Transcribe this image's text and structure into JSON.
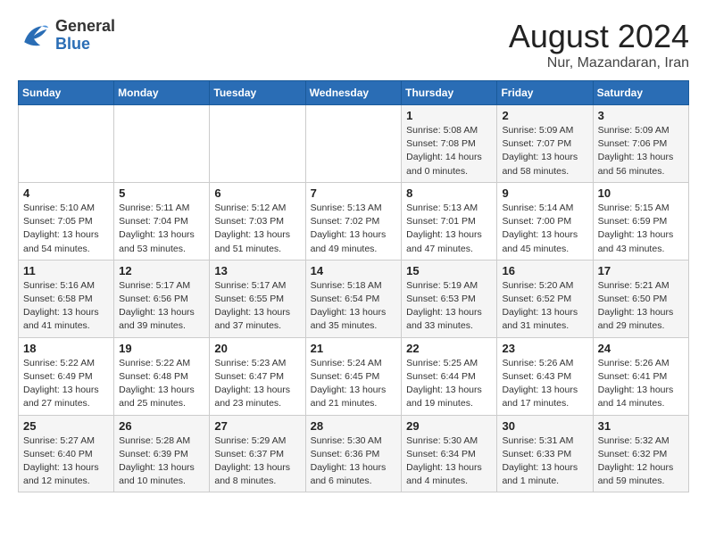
{
  "header": {
    "logo_general": "General",
    "logo_blue": "Blue",
    "title": "August 2024",
    "subtitle": "Nur, Mazandaran, Iran"
  },
  "calendar": {
    "days_of_week": [
      "Sunday",
      "Monday",
      "Tuesday",
      "Wednesday",
      "Thursday",
      "Friday",
      "Saturday"
    ],
    "weeks": [
      [
        {
          "day": "",
          "info": ""
        },
        {
          "day": "",
          "info": ""
        },
        {
          "day": "",
          "info": ""
        },
        {
          "day": "",
          "info": ""
        },
        {
          "day": "1",
          "info": "Sunrise: 5:08 AM\nSunset: 7:08 PM\nDaylight: 14 hours\nand 0 minutes."
        },
        {
          "day": "2",
          "info": "Sunrise: 5:09 AM\nSunset: 7:07 PM\nDaylight: 13 hours\nand 58 minutes."
        },
        {
          "day": "3",
          "info": "Sunrise: 5:09 AM\nSunset: 7:06 PM\nDaylight: 13 hours\nand 56 minutes."
        }
      ],
      [
        {
          "day": "4",
          "info": "Sunrise: 5:10 AM\nSunset: 7:05 PM\nDaylight: 13 hours\nand 54 minutes."
        },
        {
          "day": "5",
          "info": "Sunrise: 5:11 AM\nSunset: 7:04 PM\nDaylight: 13 hours\nand 53 minutes."
        },
        {
          "day": "6",
          "info": "Sunrise: 5:12 AM\nSunset: 7:03 PM\nDaylight: 13 hours\nand 51 minutes."
        },
        {
          "day": "7",
          "info": "Sunrise: 5:13 AM\nSunset: 7:02 PM\nDaylight: 13 hours\nand 49 minutes."
        },
        {
          "day": "8",
          "info": "Sunrise: 5:13 AM\nSunset: 7:01 PM\nDaylight: 13 hours\nand 47 minutes."
        },
        {
          "day": "9",
          "info": "Sunrise: 5:14 AM\nSunset: 7:00 PM\nDaylight: 13 hours\nand 45 minutes."
        },
        {
          "day": "10",
          "info": "Sunrise: 5:15 AM\nSunset: 6:59 PM\nDaylight: 13 hours\nand 43 minutes."
        }
      ],
      [
        {
          "day": "11",
          "info": "Sunrise: 5:16 AM\nSunset: 6:58 PM\nDaylight: 13 hours\nand 41 minutes."
        },
        {
          "day": "12",
          "info": "Sunrise: 5:17 AM\nSunset: 6:56 PM\nDaylight: 13 hours\nand 39 minutes."
        },
        {
          "day": "13",
          "info": "Sunrise: 5:17 AM\nSunset: 6:55 PM\nDaylight: 13 hours\nand 37 minutes."
        },
        {
          "day": "14",
          "info": "Sunrise: 5:18 AM\nSunset: 6:54 PM\nDaylight: 13 hours\nand 35 minutes."
        },
        {
          "day": "15",
          "info": "Sunrise: 5:19 AM\nSunset: 6:53 PM\nDaylight: 13 hours\nand 33 minutes."
        },
        {
          "day": "16",
          "info": "Sunrise: 5:20 AM\nSunset: 6:52 PM\nDaylight: 13 hours\nand 31 minutes."
        },
        {
          "day": "17",
          "info": "Sunrise: 5:21 AM\nSunset: 6:50 PM\nDaylight: 13 hours\nand 29 minutes."
        }
      ],
      [
        {
          "day": "18",
          "info": "Sunrise: 5:22 AM\nSunset: 6:49 PM\nDaylight: 13 hours\nand 27 minutes."
        },
        {
          "day": "19",
          "info": "Sunrise: 5:22 AM\nSunset: 6:48 PM\nDaylight: 13 hours\nand 25 minutes."
        },
        {
          "day": "20",
          "info": "Sunrise: 5:23 AM\nSunset: 6:47 PM\nDaylight: 13 hours\nand 23 minutes."
        },
        {
          "day": "21",
          "info": "Sunrise: 5:24 AM\nSunset: 6:45 PM\nDaylight: 13 hours\nand 21 minutes."
        },
        {
          "day": "22",
          "info": "Sunrise: 5:25 AM\nSunset: 6:44 PM\nDaylight: 13 hours\nand 19 minutes."
        },
        {
          "day": "23",
          "info": "Sunrise: 5:26 AM\nSunset: 6:43 PM\nDaylight: 13 hours\nand 17 minutes."
        },
        {
          "day": "24",
          "info": "Sunrise: 5:26 AM\nSunset: 6:41 PM\nDaylight: 13 hours\nand 14 minutes."
        }
      ],
      [
        {
          "day": "25",
          "info": "Sunrise: 5:27 AM\nSunset: 6:40 PM\nDaylight: 13 hours\nand 12 minutes."
        },
        {
          "day": "26",
          "info": "Sunrise: 5:28 AM\nSunset: 6:39 PM\nDaylight: 13 hours\nand 10 minutes."
        },
        {
          "day": "27",
          "info": "Sunrise: 5:29 AM\nSunset: 6:37 PM\nDaylight: 13 hours\nand 8 minutes."
        },
        {
          "day": "28",
          "info": "Sunrise: 5:30 AM\nSunset: 6:36 PM\nDaylight: 13 hours\nand 6 minutes."
        },
        {
          "day": "29",
          "info": "Sunrise: 5:30 AM\nSunset: 6:34 PM\nDaylight: 13 hours\nand 4 minutes."
        },
        {
          "day": "30",
          "info": "Sunrise: 5:31 AM\nSunset: 6:33 PM\nDaylight: 13 hours\nand 1 minute."
        },
        {
          "day": "31",
          "info": "Sunrise: 5:32 AM\nSunset: 6:32 PM\nDaylight: 12 hours\nand 59 minutes."
        }
      ]
    ]
  }
}
